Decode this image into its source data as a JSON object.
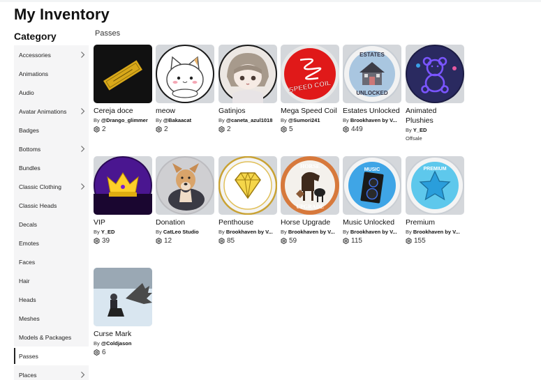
{
  "page": {
    "title": "My Inventory",
    "category_heading": "Category",
    "section_label": "Passes"
  },
  "sidebar": {
    "items": [
      {
        "label": "Accessories",
        "chevron": true
      },
      {
        "label": "Animations",
        "chevron": false
      },
      {
        "label": "Audio",
        "chevron": false
      },
      {
        "label": "Avatar Animations",
        "chevron": true
      },
      {
        "label": "Badges",
        "chevron": false
      },
      {
        "label": "Bottoms",
        "chevron": true
      },
      {
        "label": "Bundles",
        "chevron": false
      },
      {
        "label": "Classic Clothing",
        "chevron": true
      },
      {
        "label": "Classic Heads",
        "chevron": false
      },
      {
        "label": "Decals",
        "chevron": false
      },
      {
        "label": "Emotes",
        "chevron": false
      },
      {
        "label": "Faces",
        "chevron": false
      },
      {
        "label": "Hair",
        "chevron": false
      },
      {
        "label": "Heads",
        "chevron": false
      },
      {
        "label": "Meshes",
        "chevron": false
      },
      {
        "label": "Models & Packages",
        "chevron": false
      },
      {
        "label": "Passes",
        "chevron": false,
        "active": true
      },
      {
        "label": "Places",
        "chevron": true
      }
    ]
  },
  "passes": [
    {
      "name": "Cereja doce",
      "by": "By",
      "creator": "@Drango_glimmer",
      "price": "2",
      "icon": "gold-ticket-icon"
    },
    {
      "name": "meow",
      "by": "By",
      "creator": "@Bakaacat",
      "price": "2",
      "icon": "cat-icon"
    },
    {
      "name": "Gatinjos",
      "by": "By",
      "creator": "@caneta_azul1018",
      "price": "2",
      "icon": "anime-girl-icon"
    },
    {
      "name": "Mega Speed Coil",
      "by": "By",
      "creator": "@Sumori241",
      "price": "5",
      "icon": "speed-coil-icon"
    },
    {
      "name": "Estates Unlocked",
      "by": "By",
      "creator": "Brookhaven by V...",
      "price": "449",
      "icon": "house-icon"
    },
    {
      "name": "Animated Plushies",
      "by": "By",
      "creator": "Y_ED",
      "price": "",
      "offsale": "Offsale",
      "icon": "teddy-bear-icon"
    },
    {
      "name": "VIP",
      "by": "By",
      "creator": "Y_ED",
      "price": "39",
      "icon": "crown-icon"
    },
    {
      "name": "Donation",
      "by": "By",
      "creator": "CatLeo Studio",
      "price": "12",
      "icon": "dog-icon"
    },
    {
      "name": "Penthouse",
      "by": "By",
      "creator": "Brookhaven by V...",
      "price": "85",
      "icon": "diamond-icon"
    },
    {
      "name": "Horse Upgrade",
      "by": "By",
      "creator": "Brookhaven by V...",
      "price": "59",
      "icon": "horse-icon"
    },
    {
      "name": "Music Unlocked",
      "by": "By",
      "creator": "Brookhaven by V...",
      "price": "115",
      "icon": "speaker-icon"
    },
    {
      "name": "Premium",
      "by": "By",
      "creator": "Brookhaven by V...",
      "price": "155",
      "icon": "star-icon"
    },
    {
      "name": "Curse Mark",
      "by": "By",
      "creator": "@Coldjason",
      "price": "6",
      "icon": "winged-figure-icon"
    }
  ],
  "badge_text": {
    "speed_coil": "SPEED COIL",
    "estates_top": "ESTATES",
    "estates_bottom": "UNLOCKED",
    "horse_top": "HORSE",
    "horse_bottom": "UPGRADE",
    "music": "MUSIC",
    "premium": "PREMIUM"
  }
}
